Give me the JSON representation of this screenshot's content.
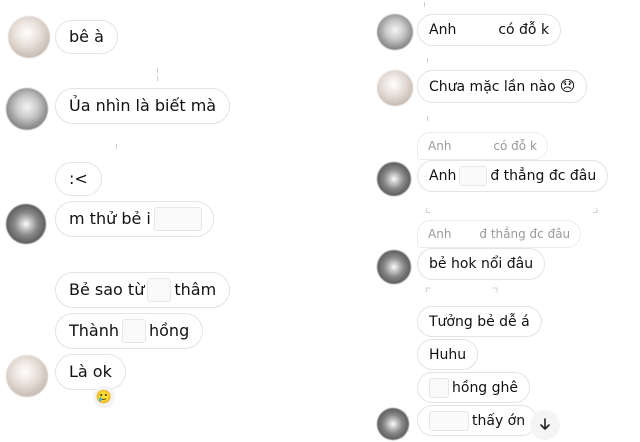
{
  "left": {
    "msg1": "bê à",
    "msg2": "Ủa nhìn là biết mà",
    "msg3": ":<",
    "msg4_pre": "m thử bẻ i",
    "msg5_pre": "Bẻ sao từ",
    "msg5_post": "thâm",
    "msg6_pre": "Thành",
    "msg6_post": "hồng",
    "msg7": "Là ok",
    "reaction": "🥲"
  },
  "right": {
    "msg1_pre": "Anh",
    "msg1_post": "có đỗ k",
    "msg2": "Chưa mặc lần nào",
    "msg2_emoji": "😞",
    "reply1_pre": "Anh",
    "reply1_post": "có đỗ k",
    "msg3_pre": "Anh",
    "msg3_post": "đ thẳng đc đâu",
    "reply2_pre": "Anh",
    "reply2_post": "đ thẳng đc đâu",
    "msg4": "bẻ hok nổi đâu",
    "msg5": "Tưởng bẻ dễ á",
    "msg6": "Huhu",
    "msg7_post": "hồng ghê",
    "msg8_post": "thấy ớn",
    "download_icon": "download-arrow"
  }
}
